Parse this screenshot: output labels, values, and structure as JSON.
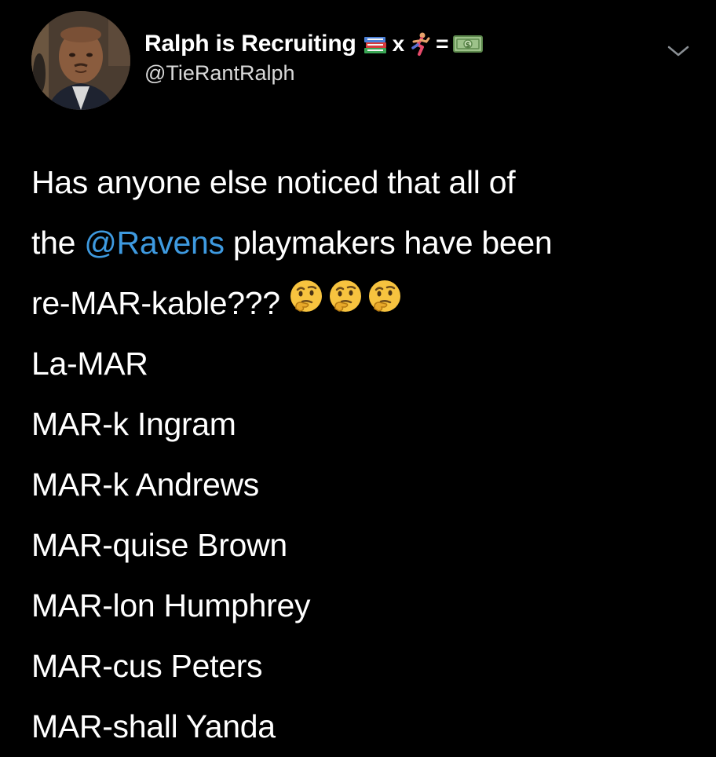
{
  "tweet": {
    "display_name": "Ralph is Recruiting",
    "name_emoji": [
      "books-emoji",
      "x",
      "runner-emoji",
      "=",
      "money-emoji"
    ],
    "name_sym_x": "x",
    "name_sym_eq": "=",
    "handle": "@TieRantRalph",
    "avatar": "profile-photo",
    "menu_icon": "chevron-down-icon",
    "body": {
      "line1": "Has anyone else noticed that all of",
      "line2_prefix": "the ",
      "mention": "@Ravens",
      "line2_suffix": " playmakers have been",
      "line3": "re-MAR-kable???",
      "line3_emojis": [
        "thinking-face-emoji",
        "thinking-face-emoji",
        "thinking-face-emoji"
      ],
      "players": [
        "La-MAR",
        "MAR-k Ingram",
        "MAR-k Andrews",
        "MAR-quise Brown",
        "MAR-lon Humphrey",
        "MAR-cus Peters",
        "MAR-shall Yanda"
      ]
    }
  },
  "colors": {
    "background": "#000000",
    "text": "#ffffff",
    "handle": "#d9d9d9",
    "mention": "#3e9ae0",
    "chevron": "#8a8f94"
  }
}
